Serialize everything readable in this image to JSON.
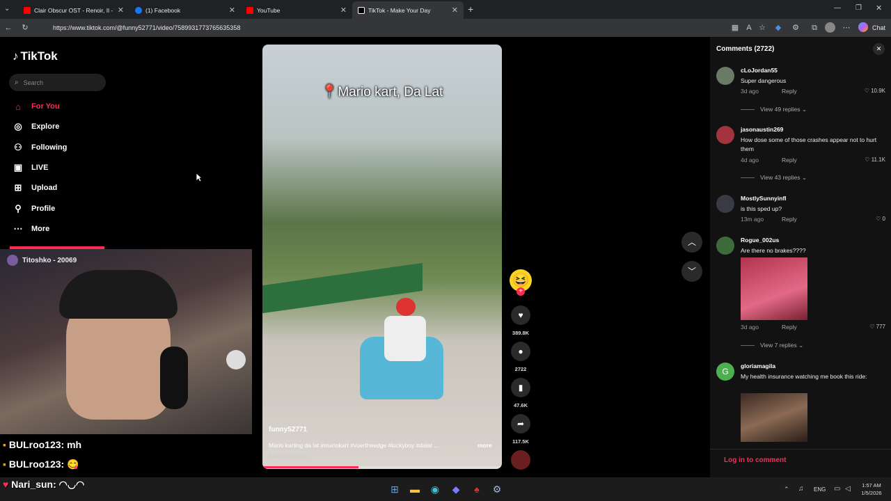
{
  "browser": {
    "tabs": [
      {
        "label": "Clair Obscur OST - Renoir, Il - You",
        "favicon": "youtube-icon",
        "color": "#ff0000"
      },
      {
        "label": "(1) Facebook",
        "favicon": "facebook-icon",
        "color": "#1877f2"
      },
      {
        "label": "YouTube",
        "favicon": "youtube-icon",
        "color": "#ff0000"
      },
      {
        "label": "TikTok - Make Your Day",
        "favicon": "tiktok-icon",
        "color": "#ffffff"
      }
    ],
    "url": "https://www.tiktok.com/@funny52771/video/7589931773765635358",
    "chat_label": "Chat"
  },
  "tiktok": {
    "logo_text": "TikTok",
    "search_placeholder": "Search",
    "nav": [
      {
        "label": "For You",
        "icon": "home-icon"
      },
      {
        "label": "Explore",
        "icon": "compass-icon"
      },
      {
        "label": "Following",
        "icon": "following-icon"
      },
      {
        "label": "LIVE",
        "icon": "live-icon"
      },
      {
        "label": "Upload",
        "icon": "upload-icon"
      },
      {
        "label": "Profile",
        "icon": "profile-icon"
      },
      {
        "label": "More",
        "icon": "more-icon"
      }
    ],
    "accent": "#fe2c55"
  },
  "stream": {
    "streamer": "Titoshko - 20069",
    "chat": [
      {
        "user": "BULroo123:",
        "msg": "mh"
      },
      {
        "user": "BULroo123:",
        "msg": "😋"
      },
      {
        "user": "Nari_sun:",
        "msg": "◠◡◠"
      }
    ]
  },
  "video": {
    "overlay_text": "Mario kart, Da Lat",
    "author": "funny52771",
    "caption": "Mario karting da lat #mariokart #vuertheedge #luckyboy #dalat ...",
    "more_label": "more",
    "translate_label": "See translation",
    "progress": 0.4,
    "likes": "389.8K",
    "comments": "2722",
    "saves": "47.6K",
    "shares": "117.5K"
  },
  "comments_panel": {
    "title": "Comments (2722)",
    "login_label": "Log in to comment",
    "items": [
      {
        "user": "cLoJordan55",
        "text": "Super dangerous",
        "time": "3d ago",
        "reply": "Reply",
        "likes": "10.9K",
        "view_replies": "View 49 replies"
      },
      {
        "user": "jasonaustin269",
        "text": "How dose some of those crashes appear not to hurt them",
        "time": "4d ago",
        "reply": "Reply",
        "likes": "11.1K",
        "view_replies": "View 43 replies"
      },
      {
        "user": "MostlySunnyinfl",
        "text": "is this sped up?",
        "time": "13m ago",
        "reply": "Reply",
        "likes": "0",
        "view_replies": ""
      },
      {
        "user": "Rogue_002us",
        "text": "Are there no brakes????",
        "time": "3d ago",
        "reply": "Reply",
        "likes": "777",
        "view_replies": "View 7 replies"
      },
      {
        "user": "gloriamagila",
        "text": "My health insurance watching me book this ride:",
        "time": "",
        "reply": "",
        "likes": "",
        "view_replies": ""
      }
    ]
  },
  "taskbar": {
    "lang": "ENG",
    "time": "1:57 AM",
    "date": "1/5/2026"
  }
}
